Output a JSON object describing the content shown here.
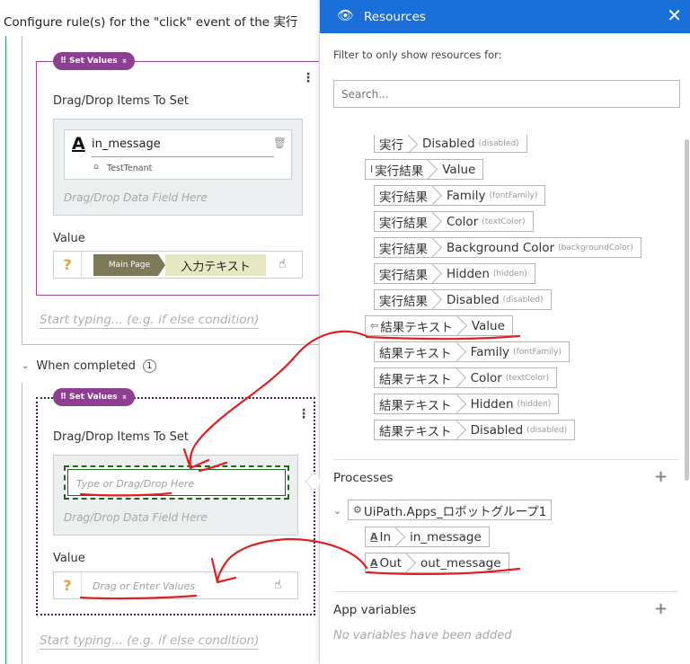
{
  "editor": {
    "title": "Configure rule(s) for the \"click\" event of the 実行",
    "card1": {
      "pill": "Set Values",
      "drag_label": "Drag/Drop Items To Set",
      "item_name": "in_message",
      "tenant": "TestTenant",
      "drop_placeholder": "Drag/Drop Data Field Here",
      "value_label": "Value",
      "crumb_page": "Main Page",
      "crumb_field": "入力テキスト"
    },
    "start_typing_1": "Start typing... (e.g. if else condition)",
    "when_completed": "When completed",
    "when_completed_count": "1",
    "card2": {
      "pill": "Set Values",
      "drag_label": "Drag/Drop Items To Set",
      "target_placeholder": "Type or Drag/Drop Here",
      "drop_placeholder": "Drag/Drop Data Field Here",
      "value_label": "Value",
      "value_placeholder": "Drag or Enter Values"
    },
    "start_typing_2": "Start typing... (e.g. if else condition)"
  },
  "panel": {
    "title": "Resources",
    "filter_label": "Filter to only show resources for:",
    "search_placeholder": "Search...",
    "tags": [
      {
        "a": "実行",
        "b": "Disabled",
        "hint": "(disabled)"
      },
      {
        "a": "実行結果",
        "b": "Value",
        "hint": ""
      },
      {
        "a": "実行結果",
        "b": "Family",
        "hint": "(fontFamily)"
      },
      {
        "a": "実行結果",
        "b": "Color",
        "hint": "(textColor)"
      },
      {
        "a": "実行結果",
        "b": "Background Color",
        "hint": "(backgroundColor)"
      },
      {
        "a": "実行結果",
        "b": "Hidden",
        "hint": "(hidden)"
      },
      {
        "a": "実行結果",
        "b": "Disabled",
        "hint": "(disabled)"
      },
      {
        "a": "結果テキスト",
        "b": "Value",
        "hint": ""
      },
      {
        "a": "結果テキスト",
        "b": "Family",
        "hint": "(fontFamily)"
      },
      {
        "a": "結果テキスト",
        "b": "Color",
        "hint": "(textColor)"
      },
      {
        "a": "結果テキスト",
        "b": "Hidden",
        "hint": "(hidden)"
      },
      {
        "a": "結果テキスト",
        "b": "Disabled",
        "hint": "(disabled)"
      }
    ],
    "processes_label": "Processes",
    "process_name": "UiPath.Apps_ロボットグループ1",
    "arg_in": {
      "dir": "In",
      "name": "in_message"
    },
    "arg_out": {
      "dir": "Out",
      "name": "out_message"
    },
    "app_vars_label": "App variables",
    "no_vars": "No variables have been added"
  },
  "colors": {
    "panel_header": "#1a6fd9",
    "pill": "#8d3f91",
    "annotation": "#e02020"
  }
}
